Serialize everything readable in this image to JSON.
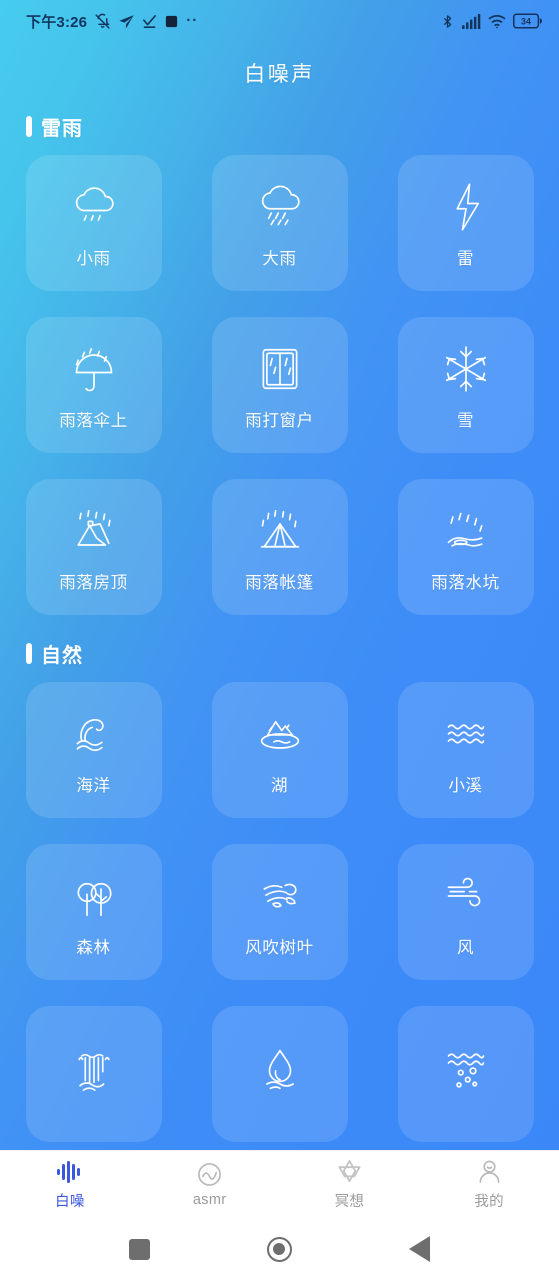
{
  "status_bar": {
    "time": "下午3:26",
    "left_icons": [
      "bell-muted-icon",
      "telegram-send-icon",
      "checkmark-icon",
      "dark-square-icon",
      "more-dots-icon"
    ],
    "right_icons": [
      "bluetooth-icon",
      "signal-bars-icon",
      "wifi-icon",
      "battery-icon"
    ],
    "battery_level": "34",
    "text_color": "#14335c"
  },
  "header": {
    "title": "白噪声"
  },
  "theme": {
    "gradient_start": "#46CCEE",
    "gradient_end": "#3B87F8",
    "tile_fill": "rgba(255,255,255,0.135)",
    "accent": "#3B57E0",
    "text_on_gradient": "#FFFFFF",
    "tab_inactive": "#9B9B9B"
  },
  "sections": [
    {
      "title": "雷雨",
      "items": [
        {
          "label": "小雨",
          "icon": "light-rain-cloud-icon"
        },
        {
          "label": "大雨",
          "icon": "heavy-rain-cloud-icon"
        },
        {
          "label": "雷",
          "icon": "lightning-bolt-icon"
        },
        {
          "label": "雨落伞上",
          "icon": "umbrella-rain-icon"
        },
        {
          "label": "雨打窗户",
          "icon": "rain-window-icon"
        },
        {
          "label": "雪",
          "icon": "snowflake-icon"
        },
        {
          "label": "雨落房顶",
          "icon": "rain-roof-icon"
        },
        {
          "label": "雨落帐篷",
          "icon": "rain-tent-icon"
        },
        {
          "label": "雨落水坑",
          "icon": "rain-puddle-icon"
        }
      ]
    },
    {
      "title": "自然",
      "items": [
        {
          "label": "海洋",
          "icon": "ocean-wave-icon"
        },
        {
          "label": "湖",
          "icon": "lake-mountain-icon"
        },
        {
          "label": "小溪",
          "icon": "stream-waves-icon"
        },
        {
          "label": "森林",
          "icon": "forest-trees-icon"
        },
        {
          "label": "风吹树叶",
          "icon": "wind-leaves-icon"
        },
        {
          "label": "风",
          "icon": "wind-icon"
        },
        {
          "label": "",
          "icon": "waterfall-icon"
        },
        {
          "label": "",
          "icon": "water-drop-icon"
        },
        {
          "label": "",
          "icon": "underwater-bubbles-icon"
        }
      ]
    }
  ],
  "tabs": [
    {
      "label": "白噪",
      "icon": "sound-wave-icon",
      "active": true
    },
    {
      "label": "asmr",
      "icon": "asmr-circle-wave-icon",
      "active": false
    },
    {
      "label": "冥想",
      "icon": "meditation-star-icon",
      "active": false
    },
    {
      "label": "我的",
      "icon": "user-profile-icon",
      "active": false
    }
  ],
  "android_nav": {
    "recents_label": "recents-square",
    "home_label": "home-circle",
    "back_label": "back-triangle"
  }
}
